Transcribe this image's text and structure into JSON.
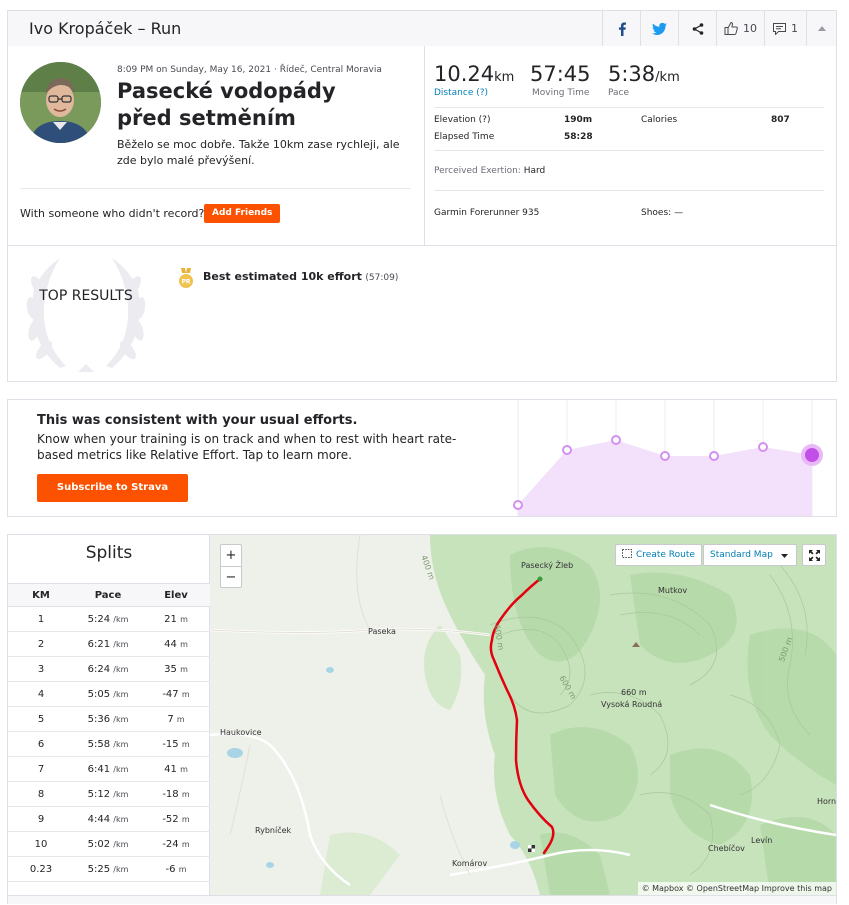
{
  "header": {
    "title": "Ivo Kropáček – Run",
    "kudos_count": "10",
    "comment_count": "1"
  },
  "activity": {
    "meta": "8:09 PM on Sunday, May 16, 2021 · Řídeč, Central Moravia",
    "title": "Pasecké vodopády před setměním",
    "description": "Běželo se moc dobře. Takže 10km zase rychleji, ale zde bylo malé převýšení.",
    "with_prompt": "With someone who didn't record?",
    "add_friends": "Add Friends"
  },
  "stats": {
    "distance": "10.24",
    "distance_unit": "km",
    "distance_label": "Distance (?)",
    "moving_time": "57:45",
    "moving_time_label": "Moving Time",
    "pace": "5:38",
    "pace_unit": "/km",
    "pace_label": "Pace",
    "elevation_label": "Elevation (?)",
    "elevation": "190m",
    "calories_label": "Calories",
    "calories": "807",
    "elapsed_label": "Elapsed Time",
    "elapsed": "58:28",
    "exertion_label": "Perceived Exertion:",
    "exertion": "Hard",
    "device": "Garmin Forerunner 935",
    "shoes_label": "Shoes:",
    "shoes": "—"
  },
  "top_results": {
    "heading": "TOP RESULTS",
    "pr_badge": "PR",
    "best_label": "Best estimated 10k effort",
    "best_time": "(57:09)"
  },
  "effort": {
    "heading": "This was consistent with your usual efforts.",
    "text": "Know when your training is on track and when to rest with heart rate-based metrics like Relative Effort. Tap to learn more.",
    "button": "Subscribe to Strava",
    "accent": "#fc5200",
    "line_color": "#d38ff0",
    "levels": [
      0.05,
      0.6,
      0.7,
      0.54,
      0.54,
      0.63,
      0.55
    ]
  },
  "splits": {
    "title": "Splits",
    "columns": [
      "KM",
      "Pace",
      "Elev"
    ],
    "pace_unit": "/km",
    "elev_unit": "m",
    "rows": [
      {
        "km": "1",
        "pace": "5:24",
        "elev": "21"
      },
      {
        "km": "2",
        "pace": "6:21",
        "elev": "44"
      },
      {
        "km": "3",
        "pace": "6:24",
        "elev": "35"
      },
      {
        "km": "4",
        "pace": "5:05",
        "elev": "-47"
      },
      {
        "km": "5",
        "pace": "5:36",
        "elev": "7"
      },
      {
        "km": "6",
        "pace": "5:58",
        "elev": "-15"
      },
      {
        "km": "7",
        "pace": "6:41",
        "elev": "41"
      },
      {
        "km": "8",
        "pace": "5:12",
        "elev": "-18"
      },
      {
        "km": "9",
        "pace": "4:44",
        "elev": "-52"
      },
      {
        "km": "10",
        "pace": "5:02",
        "elev": "-24"
      },
      {
        "km": "0.23",
        "pace": "5:25",
        "elev": "-6"
      }
    ]
  },
  "map": {
    "zoom_in": "+",
    "zoom_out": "−",
    "create_route": "Create Route",
    "style": "Standard Map",
    "places": {
      "pasecky_zleb": "Pasecký Žleb",
      "paseka": "Paseka",
      "mutkov": "Mutkov",
      "peak_alt": "660 m",
      "peak_name": "Vysoká Roudná",
      "haukovice": "Haukovice",
      "rybnicek": "Rybníček",
      "komarov": "Komárov",
      "levin": "Levín",
      "chebicov": "Chebíčov",
      "horni": "Horní",
      "c400": "400 m",
      "c600": "600 m",
      "c500": "500 m",
      "c600b": "600 m"
    },
    "attribution": "© Mapbox © OpenStreetMap Improve this map",
    "route_color": "#e3000f"
  }
}
